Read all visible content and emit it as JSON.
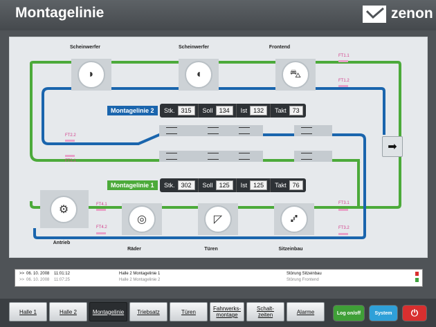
{
  "header": {
    "title": "Montagelinie",
    "logo_text": "zenon"
  },
  "stations_top": [
    {
      "label": "Scheinwerfer",
      "icon": "headlight-icon"
    },
    {
      "label": "Scheinwerfer",
      "icon": "headlight-icon"
    },
    {
      "label": "Frontend",
      "icon": "car-front-icon"
    }
  ],
  "stations_bottom": [
    {
      "label": "Antrieb",
      "icon": "engine-icon"
    },
    {
      "label": "Räder",
      "icon": "wheels-icon"
    },
    {
      "label": "Türen",
      "icon": "door-icon"
    },
    {
      "label": "Sitzeinbau",
      "icon": "seat-icon"
    }
  ],
  "ft_labels": {
    "ft11": "FT1.1",
    "ft12": "FT1.2",
    "ft21": "FT2.1",
    "ft22": "FT2.2",
    "ft31": "FT3.1",
    "ft32": "FT3.2",
    "ft41": "FT4.1",
    "ft42": "FT4.2"
  },
  "line2": {
    "name": "Montagelinie 2",
    "color": "#1a65ad",
    "counters": [
      {
        "label": "Stk.",
        "value": "315"
      },
      {
        "label": "Soll",
        "value": "134"
      },
      {
        "label": "Ist",
        "value": "132"
      },
      {
        "label": "Takt",
        "value": "73"
      }
    ]
  },
  "line1": {
    "name": "Montagelinie 1",
    "color": "#4caa3a",
    "counters": [
      {
        "label": "Stk.",
        "value": "302"
      },
      {
        "label": "Soll",
        "value": "125"
      },
      {
        "label": "Ist",
        "value": "125"
      },
      {
        "label": "Takt",
        "value": "76"
      }
    ]
  },
  "alarms": [
    {
      "mark": ">>",
      "date": "06. 10. 2008",
      "time": "11:01:12",
      "source": "Halle 2 Montagelinie 1",
      "message": "Störung Sitzeinbau",
      "status_color": "#d93030"
    },
    {
      "mark": ">>",
      "date": "06. 10. 2008",
      "time": "11:07:25",
      "source": "Halle 2 Montagelinie 2",
      "message": "Störung Frontend",
      "status_color": "#3fa33f"
    }
  ],
  "nav": [
    "Halle 1",
    "Halle 2",
    "Montagelinie",
    "Triebsatz",
    "Türen",
    "Fahrwerks-\nmontage",
    "Schalt-\nzeiten",
    "Alarme"
  ],
  "nav_active": "Montagelinie",
  "actions": {
    "login": "Log on/off",
    "system": "System"
  }
}
